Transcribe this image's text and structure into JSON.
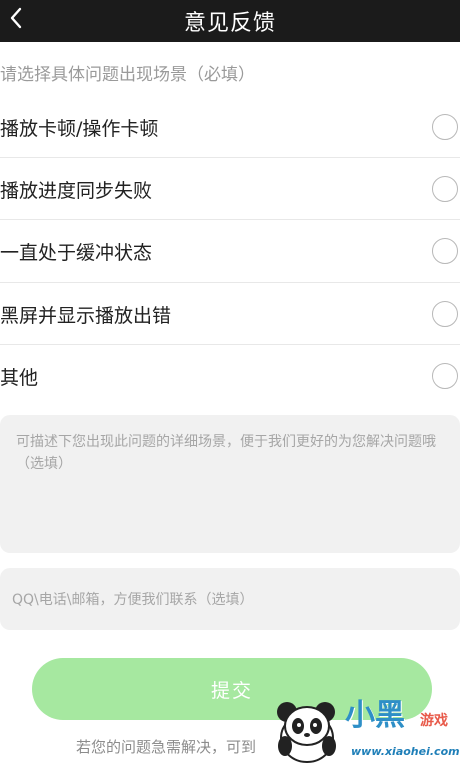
{
  "header": {
    "title": "意见反馈",
    "back_icon": "chevron-left-icon"
  },
  "form": {
    "prompt": "请选择具体问题出现场景（必填）",
    "options": [
      {
        "label": "播放卡顿/操作卡顿",
        "selected": false
      },
      {
        "label": "播放进度同步失败",
        "selected": false
      },
      {
        "label": "一直处于缓冲状态",
        "selected": false
      },
      {
        "label": "黑屏并显示播放出错",
        "selected": false
      },
      {
        "label": "其他",
        "selected": false
      }
    ],
    "detail_placeholder": "可描述下您出现此问题的详细场景，便于我们更好的为您解决问题哦（选填）",
    "contact_placeholder": "QQ\\电话\\邮箱，方便我们联系（选填）",
    "submit_label": "提交",
    "footer_note": "若您的问题急需解决，可到",
    "accent_color": "#a6e8a0"
  },
  "watermark": {
    "brand": "小黑",
    "sub": "游戏",
    "url": "www.xiaohei.com"
  }
}
